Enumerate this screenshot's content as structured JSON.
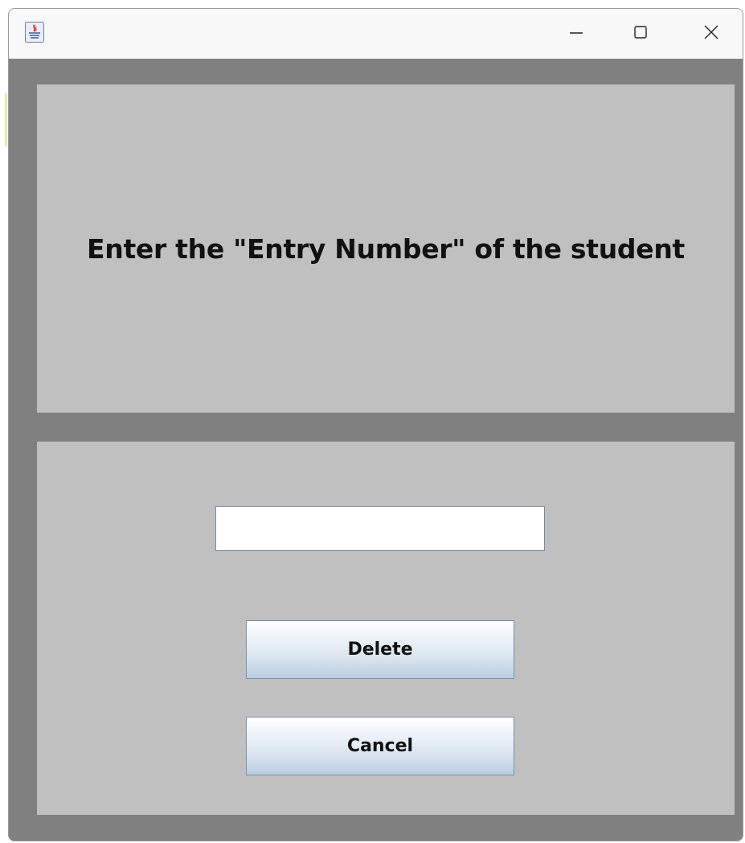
{
  "window": {
    "title": "",
    "app_icon": "java-icon",
    "controls": {
      "minimize": "minimize-icon",
      "maximize": "maximize-icon",
      "close": "close-icon"
    }
  },
  "prompt": {
    "text": "Enter the \"Entry Number\" of the student"
  },
  "form": {
    "entry_value": "",
    "entry_placeholder": ""
  },
  "buttons": {
    "delete_label": "Delete",
    "cancel_label": "Cancel"
  },
  "colors": {
    "frame": "#808080",
    "panel": "#c0c0c0",
    "titlebar": "#f8f8f8"
  }
}
